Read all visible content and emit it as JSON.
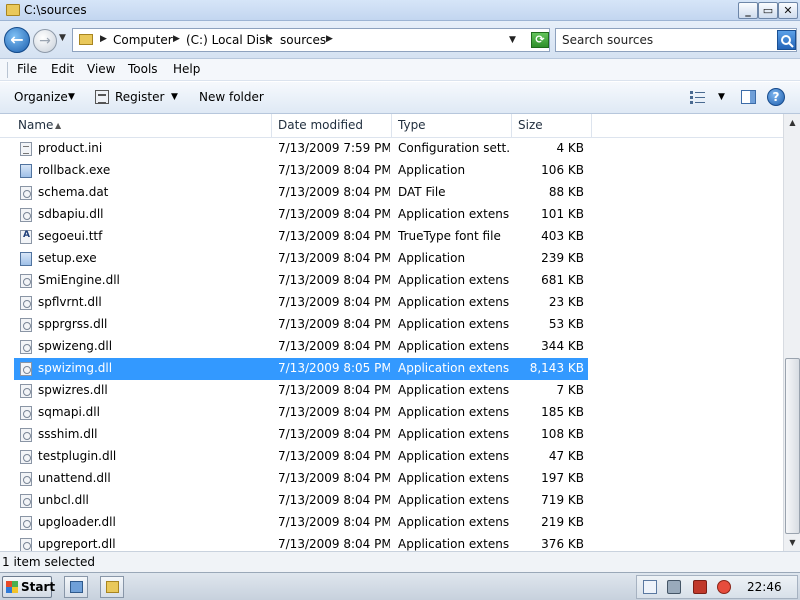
{
  "window": {
    "title": "C:\\sources"
  },
  "address": {
    "crumbs": [
      "Computer",
      "(C:) Local Disk",
      "sources"
    ],
    "search_placeholder": "Search sources"
  },
  "menu": [
    "File",
    "Edit",
    "View",
    "Tools",
    "Help"
  ],
  "commands": {
    "organize": "Organize",
    "register": "Register",
    "new_folder": "New folder"
  },
  "columns": {
    "name": "Name",
    "date": "Date modified",
    "type": "Type",
    "size": "Size"
  },
  "files": [
    {
      "name": "product.ini",
      "date": "7/13/2009 7:59 PM",
      "type": "Configuration sett...",
      "size": "4 KB",
      "icon": "ini-file-icon",
      "selected": false
    },
    {
      "name": "rollback.exe",
      "date": "7/13/2009 8:04 PM",
      "type": "Application",
      "size": "106 KB",
      "icon": "exe-file-icon",
      "selected": false
    },
    {
      "name": "schema.dat",
      "date": "7/13/2009 8:04 PM",
      "type": "DAT File",
      "size": "88 KB",
      "icon": "dat-file-icon",
      "selected": false
    },
    {
      "name": "sdbapiu.dll",
      "date": "7/13/2009 8:04 PM",
      "type": "Application extens...",
      "size": "101 KB",
      "icon": "dll-file-icon",
      "selected": false
    },
    {
      "name": "segoeui.ttf",
      "date": "7/13/2009 8:04 PM",
      "type": "TrueType font file",
      "size": "403 KB",
      "icon": "font-file-icon",
      "selected": false
    },
    {
      "name": "setup.exe",
      "date": "7/13/2009 8:04 PM",
      "type": "Application",
      "size": "239 KB",
      "icon": "setup-file-icon",
      "selected": false
    },
    {
      "name": "SmiEngine.dll",
      "date": "7/13/2009 8:04 PM",
      "type": "Application extens...",
      "size": "681 KB",
      "icon": "dll-file-icon",
      "selected": false
    },
    {
      "name": "spflvrnt.dll",
      "date": "7/13/2009 8:04 PM",
      "type": "Application extens...",
      "size": "23 KB",
      "icon": "dll-file-icon",
      "selected": false
    },
    {
      "name": "spprgrss.dll",
      "date": "7/13/2009 8:04 PM",
      "type": "Application extens...",
      "size": "53 KB",
      "icon": "dll-file-icon",
      "selected": false
    },
    {
      "name": "spwizeng.dll",
      "date": "7/13/2009 8:04 PM",
      "type": "Application extens...",
      "size": "344 KB",
      "icon": "dll-file-icon",
      "selected": false
    },
    {
      "name": "spwizimg.dll",
      "date": "7/13/2009 8:05 PM",
      "type": "Application extens...",
      "size": "8,143 KB",
      "icon": "dll-file-icon",
      "selected": true
    },
    {
      "name": "spwizres.dll",
      "date": "7/13/2009 8:04 PM",
      "type": "Application extens...",
      "size": "7 KB",
      "icon": "dll-file-icon",
      "selected": false
    },
    {
      "name": "sqmapi.dll",
      "date": "7/13/2009 8:04 PM",
      "type": "Application extens...",
      "size": "185 KB",
      "icon": "dll-file-icon",
      "selected": false
    },
    {
      "name": "ssshim.dll",
      "date": "7/13/2009 8:04 PM",
      "type": "Application extens...",
      "size": "108 KB",
      "icon": "dll-file-icon",
      "selected": false
    },
    {
      "name": "testplugin.dll",
      "date": "7/13/2009 8:04 PM",
      "type": "Application extens...",
      "size": "47 KB",
      "icon": "dll-file-icon",
      "selected": false
    },
    {
      "name": "unattend.dll",
      "date": "7/13/2009 8:04 PM",
      "type": "Application extens...",
      "size": "197 KB",
      "icon": "dll-file-icon",
      "selected": false
    },
    {
      "name": "unbcl.dll",
      "date": "7/13/2009 8:04 PM",
      "type": "Application extens...",
      "size": "719 KB",
      "icon": "dll-file-icon",
      "selected": false
    },
    {
      "name": "upgloader.dll",
      "date": "7/13/2009 8:04 PM",
      "type": "Application extens...",
      "size": "219 KB",
      "icon": "dll-file-icon",
      "selected": false
    },
    {
      "name": "upgreport.dll",
      "date": "7/13/2009 8:04 PM",
      "type": "Application extens...",
      "size": "376 KB",
      "icon": "dll-file-icon",
      "selected": false
    }
  ],
  "status": {
    "text": "1 item selected"
  },
  "taskbar": {
    "start_label": "Start",
    "clock": "22:46"
  },
  "colors": {
    "selection": "#3399ff",
    "titlebar": "#c3d6f0"
  }
}
